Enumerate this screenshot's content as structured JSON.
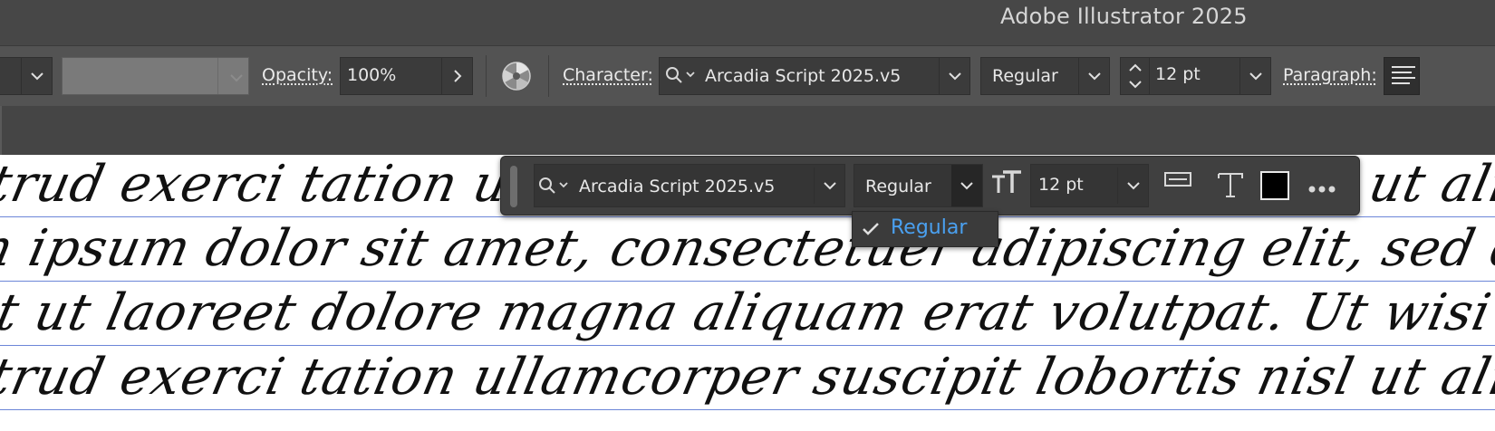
{
  "app": {
    "title": "Adobe Illustrator 2025"
  },
  "control_bar": {
    "opacity_label": "Opacity:",
    "opacity_value": "100%",
    "character_label": "Character:",
    "font_family": "Arcadia Script 2025.v5",
    "font_style": "Regular",
    "font_size": "12 pt",
    "paragraph_label": "Paragraph:"
  },
  "context_panel": {
    "font_family": "Arcadia Script 2025.v5",
    "font_style": "Regular",
    "font_size": "12 pt"
  },
  "style_dropdown": {
    "options": [
      {
        "label": "Regular",
        "selected": true
      }
    ]
  },
  "canvas": {
    "lines": [
      "strud exerci tation ullamcorper suscipit lobortis nisl ut aliquip ex",
      "m ipsum dolor sit amet, consectetuer adipiscing elit, sed diam no",
      "nt ut laoreet dolore magna aliquam erat volutpat. Ut wisi eni",
      "strud exerci tation ullamcorper suscipit lobortis nisl ut aliquip ex"
    ]
  },
  "colors": {
    "accent": "#4aa0f0",
    "baseline": "#6c86d8",
    "swatch": "#000000"
  }
}
